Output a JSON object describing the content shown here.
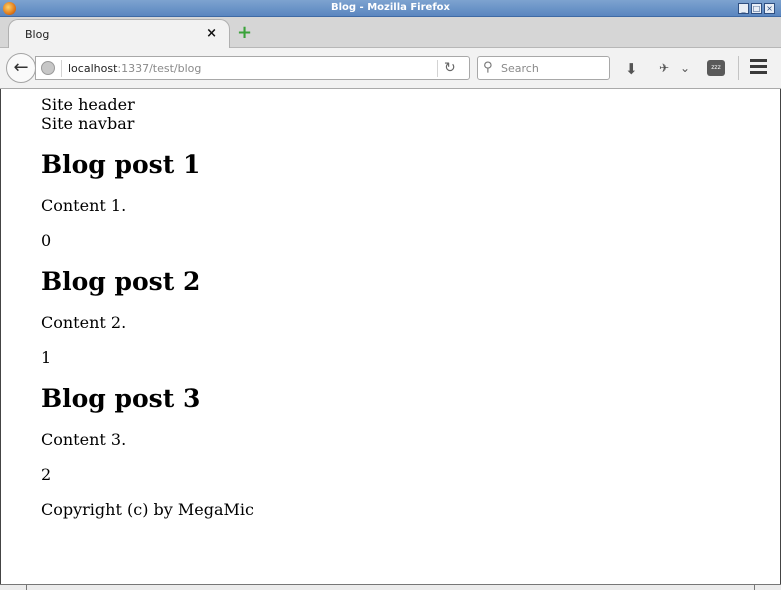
{
  "window": {
    "title": "Blog - Mozilla Firefox"
  },
  "tabs": [
    {
      "label": "Blog",
      "close": "×"
    }
  ],
  "new_tab": {
    "glyph": "+"
  },
  "nav": {
    "back_glyph": "←",
    "url_host": "localhost",
    "url_rest": ":1337/test/blog",
    "reload_glyph": "↻",
    "search_placeholder": "Search",
    "search_glyph": "⚲",
    "download_glyph": "⬇",
    "addon_glyph": "✈",
    "addon_dropdown_glyph": "⌄",
    "sleep_label": "zzz"
  },
  "page": {
    "site_header": "Site header",
    "site_navbar": "Site navbar",
    "posts": [
      {
        "title": "Blog post 1",
        "content": "Content 1.",
        "index": "0"
      },
      {
        "title": "Blog post 2",
        "content": "Content 2.",
        "index": "1"
      },
      {
        "title": "Blog post 3",
        "content": "Content 3.",
        "index": "2"
      }
    ],
    "footer": "Copyright (c) by MegaMic"
  },
  "colors": {
    "titlebar": "#5a86c0",
    "new_tab_accent": "#3aa33a"
  }
}
